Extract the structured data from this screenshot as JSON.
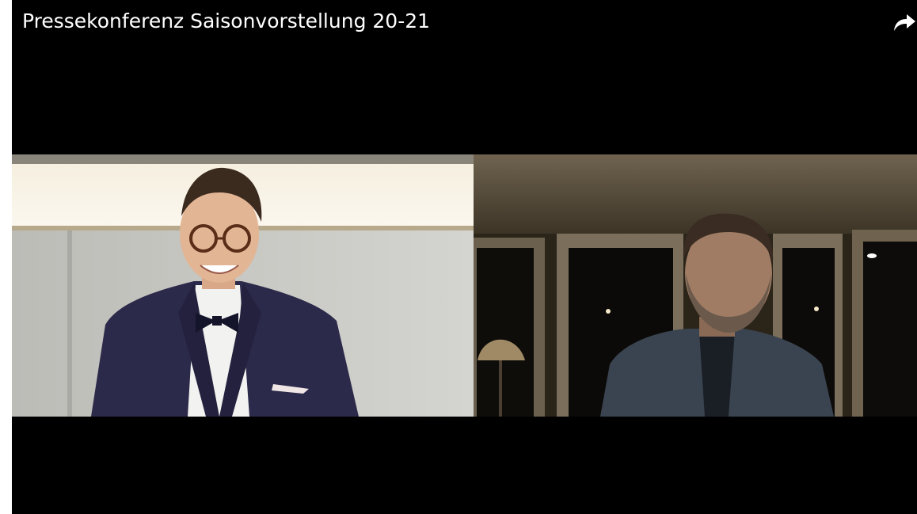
{
  "video": {
    "title": "Pressekonferenz Saisonvorstellung 20-21"
  },
  "controls": {
    "share_icon": "share-arrow-icon"
  },
  "participants": [
    {
      "role": "left-speaker"
    },
    {
      "role": "right-speaker"
    }
  ]
}
